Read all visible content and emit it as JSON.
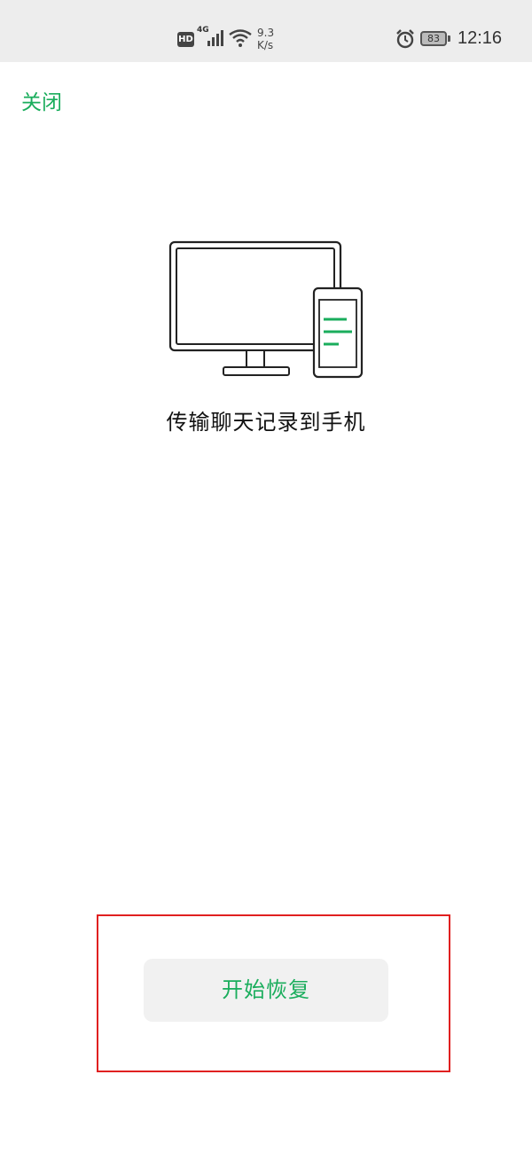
{
  "status_bar": {
    "hd_badge": "HD",
    "network": "4G",
    "speed_value": "9.3",
    "speed_unit": "K/s",
    "battery": "83",
    "time": "12:16",
    "icons": [
      "hd-icon",
      "signal-icon",
      "wifi-icon",
      "alarm-icon",
      "battery-icon"
    ]
  },
  "header": {
    "close_label": "关闭"
  },
  "main": {
    "illustration_icon": "desktop-to-phone-icon",
    "headline": "传输聊天记录到手机"
  },
  "footer": {
    "restore_button_label": "开始恢复"
  },
  "colors": {
    "accent_green": "#1aad5c",
    "highlight_red": "#e02020",
    "status_bar_bg": "#ededed",
    "button_bg": "#f1f1f1"
  }
}
